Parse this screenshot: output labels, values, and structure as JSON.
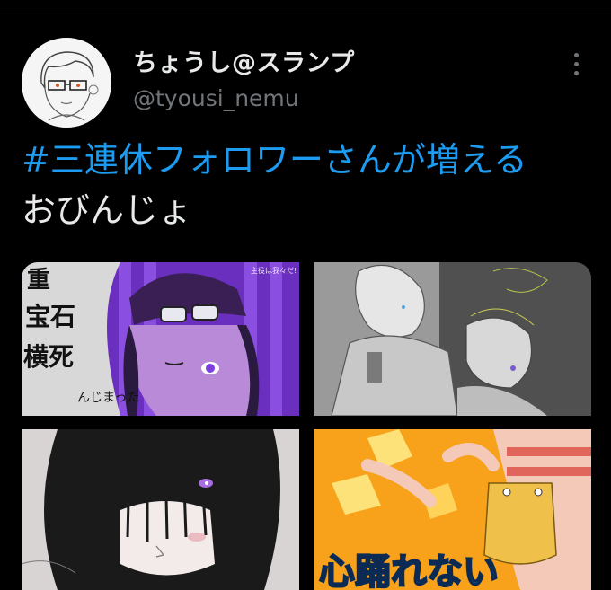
{
  "tweet": {
    "author": {
      "display_name": "ちょうし@スランプ",
      "handle": "@tyousi_nemu",
      "avatar_icon": "avatar-illustration"
    },
    "more_icon": "more-vertical-icon",
    "text": {
      "hashtag": "#三連休フォロワーさんが増える",
      "line2": "おびんじょ"
    },
    "media": [
      {
        "description_icon": "illustration-purple",
        "lettering": "重宝石での横死んじまったろうな",
        "corner_caption": "主役は我々だ!"
      },
      {
        "description_icon": "illustration-sketch-gray"
      },
      {
        "description_icon": "illustration-dark-hair"
      },
      {
        "description_icon": "illustration-orange",
        "lettering": "心踊れない"
      }
    ]
  },
  "colors": {
    "background": "#000000",
    "hashtag": "#1d9bf0",
    "primary_text": "#e7e9ea",
    "secondary_text": "#71767b"
  }
}
